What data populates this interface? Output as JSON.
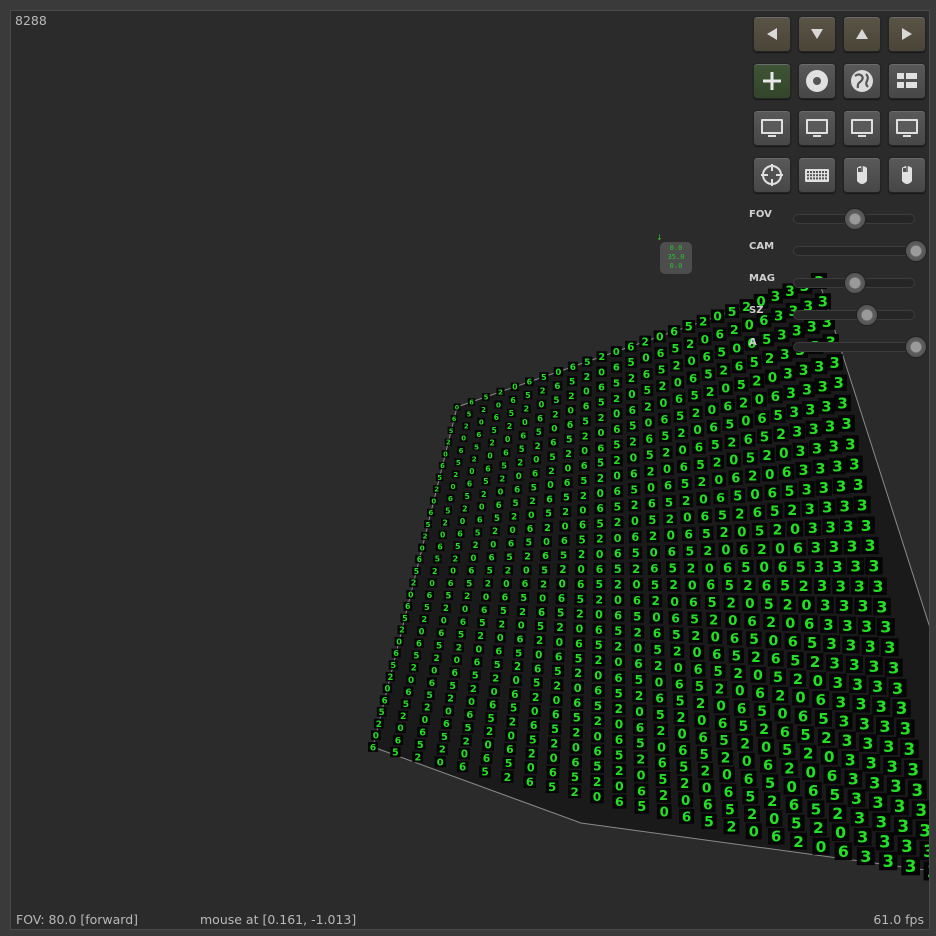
{
  "hud": {
    "count": "8288",
    "fov_status": "FOV: 80.0  [forward]",
    "mouse_status": "mouse at [0.161, -1.013]",
    "fps": "61.0 fps"
  },
  "marker": {
    "arrow": "↓",
    "lines": [
      "0.0",
      "35.0",
      "0.0"
    ]
  },
  "toolbar": {
    "rows": [
      [
        {
          "name": "pan-left-button",
          "icon": "arrow-left-icon",
          "style": "arrow"
        },
        {
          "name": "pan-down-button",
          "icon": "arrow-down-icon",
          "style": "arrow"
        },
        {
          "name": "pan-up-button",
          "icon": "arrow-up-icon",
          "style": "arrow"
        },
        {
          "name": "pan-right-button",
          "icon": "arrow-right-icon",
          "style": "arrow"
        }
      ],
      [
        {
          "name": "add-button",
          "icon": "plus-icon",
          "style": "active"
        },
        {
          "name": "disc-button",
          "icon": "disc-icon",
          "style": "normal"
        },
        {
          "name": "globe-button",
          "icon": "globe-icon",
          "style": "normal"
        },
        {
          "name": "layout-button",
          "icon": "grid-layout-icon",
          "style": "normal"
        }
      ],
      [
        {
          "name": "monitor-1-button",
          "icon": "monitor-icon",
          "style": "normal"
        },
        {
          "name": "monitor-2-button",
          "icon": "monitor-icon",
          "style": "normal"
        },
        {
          "name": "monitor-3-button",
          "icon": "monitor-icon",
          "style": "normal"
        },
        {
          "name": "monitor-4-button",
          "icon": "monitor-icon",
          "style": "normal"
        }
      ],
      [
        {
          "name": "crosshair-button",
          "icon": "crosshair-icon",
          "style": "normal"
        },
        {
          "name": "keyboard-button",
          "icon": "keyboard-icon",
          "style": "normal"
        },
        {
          "name": "mouse-left-button",
          "icon": "mouse-icon",
          "style": "normal"
        },
        {
          "name": "mouse-right-button",
          "icon": "mouse-icon",
          "style": "normal"
        }
      ]
    ]
  },
  "sliders": [
    {
      "label": "FOV",
      "value": 0.5
    },
    {
      "label": "CAM",
      "value": 1.0
    },
    {
      "label": "MAG",
      "value": 0.5
    },
    {
      "label": "SZ",
      "value": 0.6
    },
    {
      "label": "A",
      "value": 1.0
    }
  ],
  "scene": {
    "glyph_color": "#22e022",
    "edge_color": "#8a8a8a",
    "back_glyph": "3",
    "front_glyphs": [
      "0",
      "6",
      "5",
      "2"
    ]
  }
}
